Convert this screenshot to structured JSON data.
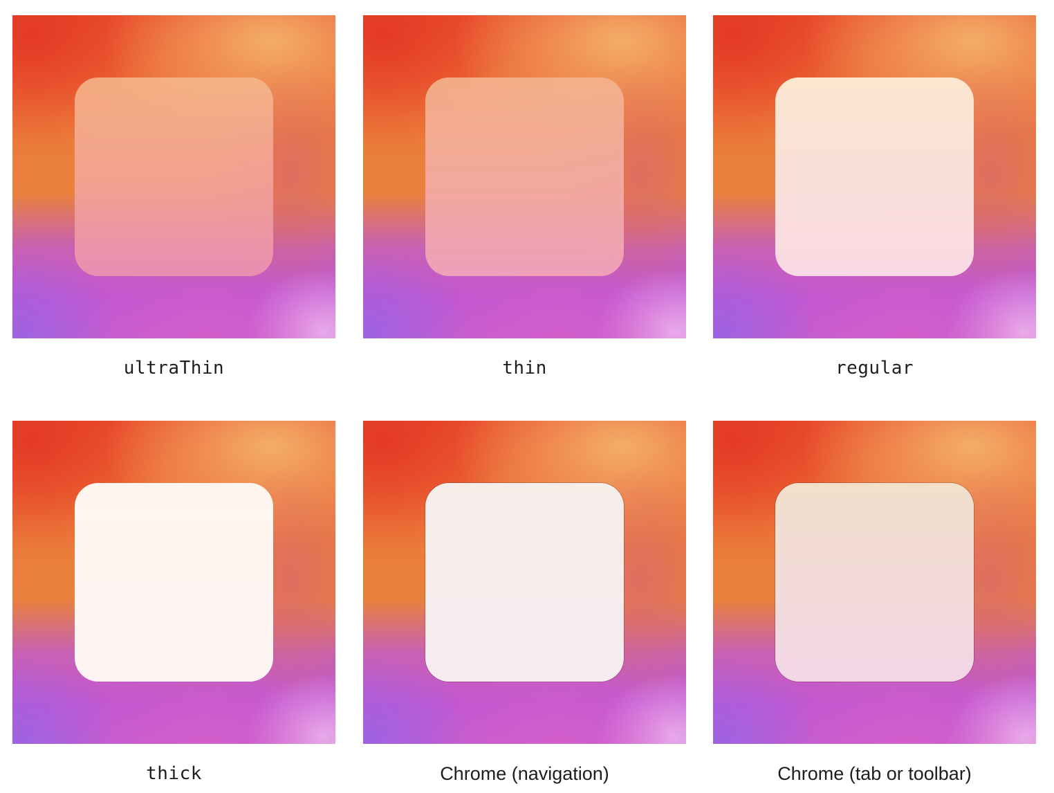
{
  "materials": [
    {
      "label": "ultraThin",
      "style": "code"
    },
    {
      "label": "thin",
      "style": "code"
    },
    {
      "label": "regular",
      "style": "code"
    },
    {
      "label": "thick",
      "style": "code"
    },
    {
      "label": "Chrome (navigation)",
      "style": "text"
    },
    {
      "label": "Chrome (tab or toolbar)",
      "style": "text"
    }
  ],
  "colors": {
    "background_red": "#e9502c",
    "background_orange": "#f4b26c",
    "background_purple": "#a163e2",
    "background_pink": "#d85fcb",
    "label_text": "#1d1d1f"
  }
}
